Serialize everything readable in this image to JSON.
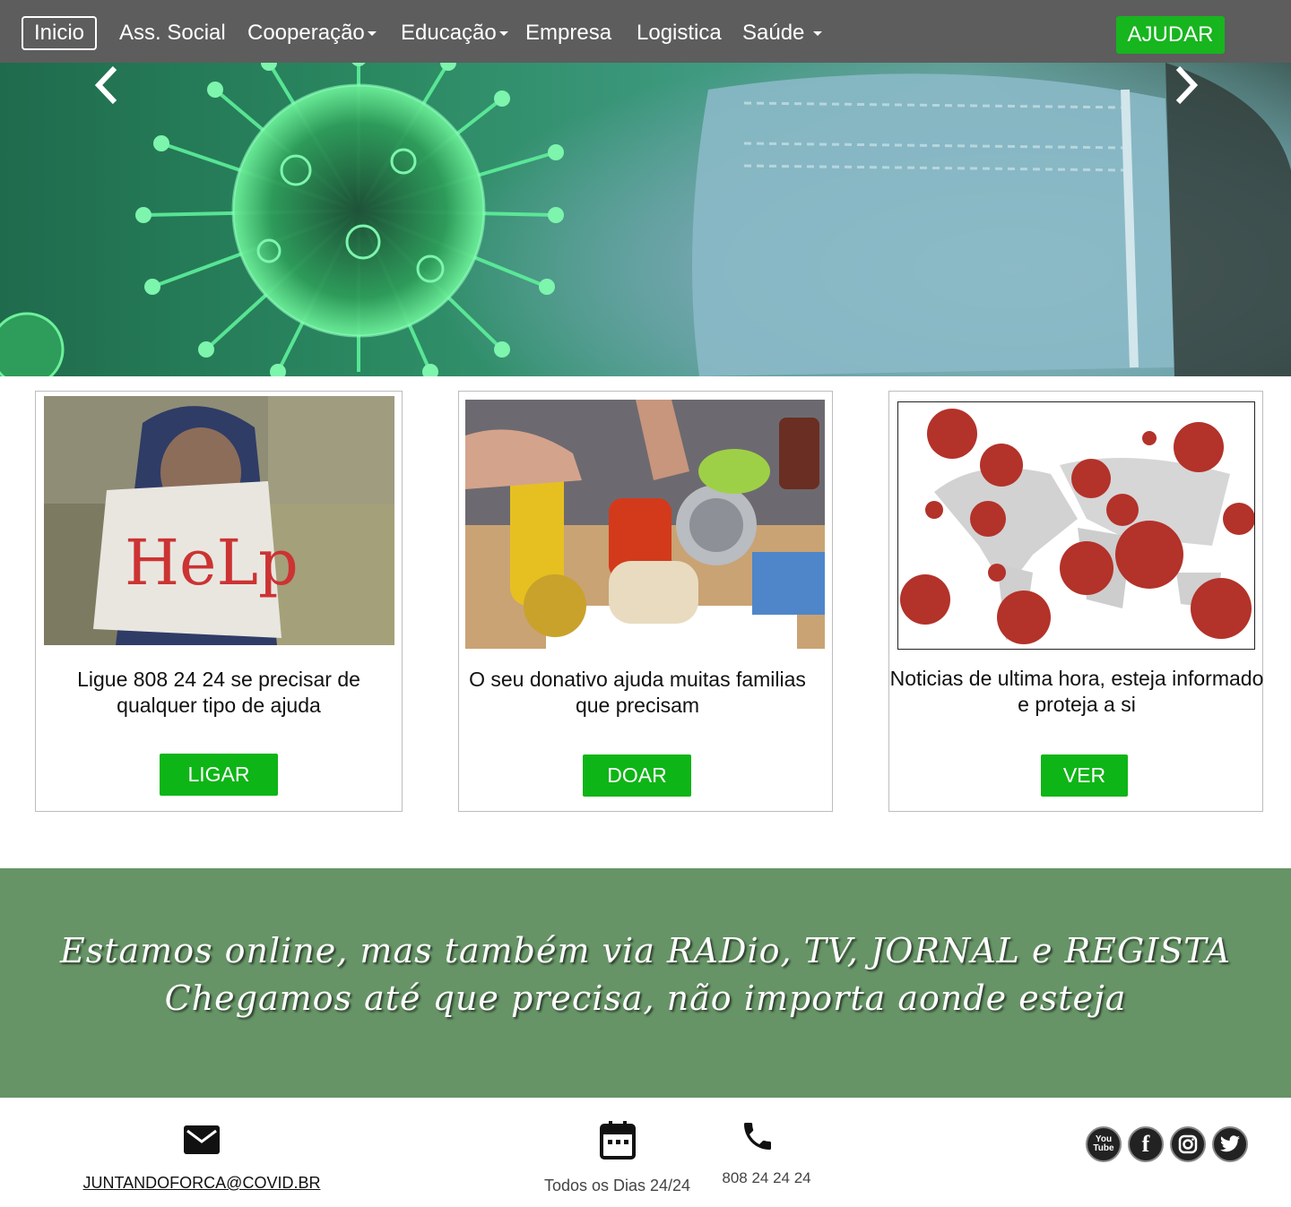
{
  "nav": {
    "items": [
      {
        "label": "Inicio"
      },
      {
        "label": "Ass. Social"
      },
      {
        "label": "Cooperação"
      },
      {
        "label": "Educação"
      },
      {
        "label": "Empresa"
      },
      {
        "label": "Logistica"
      },
      {
        "label": "Saúde"
      }
    ],
    "help_label": "AJUDAR"
  },
  "hero": {
    "prev_icon": "chevron-left-icon",
    "next_icon": "chevron-right-icon",
    "image": "virus-and-mask-photo"
  },
  "cards": [
    {
      "image": "help-sign-photo",
      "text": "Ligue 808 24 24 se precisar de qualquer tipo de ajuda",
      "button": "LIGAR"
    },
    {
      "image": "food-donation-box-photo",
      "text": "O seu donativo ajuda muitas familias que precisam",
      "button": "DOAR"
    },
    {
      "image": "world-map-virus-photo",
      "text": "Noticias de ultima hora, esteja informado e proteja a si",
      "button": "VER"
    }
  ],
  "banner": {
    "line1": "Estamos online, mas também via RADio, TV, JORNAL e REGISTA",
    "line2": "Chegamos até que precisa, não importa aonde esteja"
  },
  "footer": {
    "email": "JUNTANDOFORCA@COVID.BR",
    "schedule": "Todos os Dias 24/24",
    "phone": "808 24 24 24",
    "social": [
      "youtube-icon",
      "facebook-icon",
      "instagram-icon",
      "twitter-icon"
    ]
  },
  "colors": {
    "navbar": "#5d5d5d",
    "accent_green": "#0eb516",
    "banner": "#669466"
  }
}
